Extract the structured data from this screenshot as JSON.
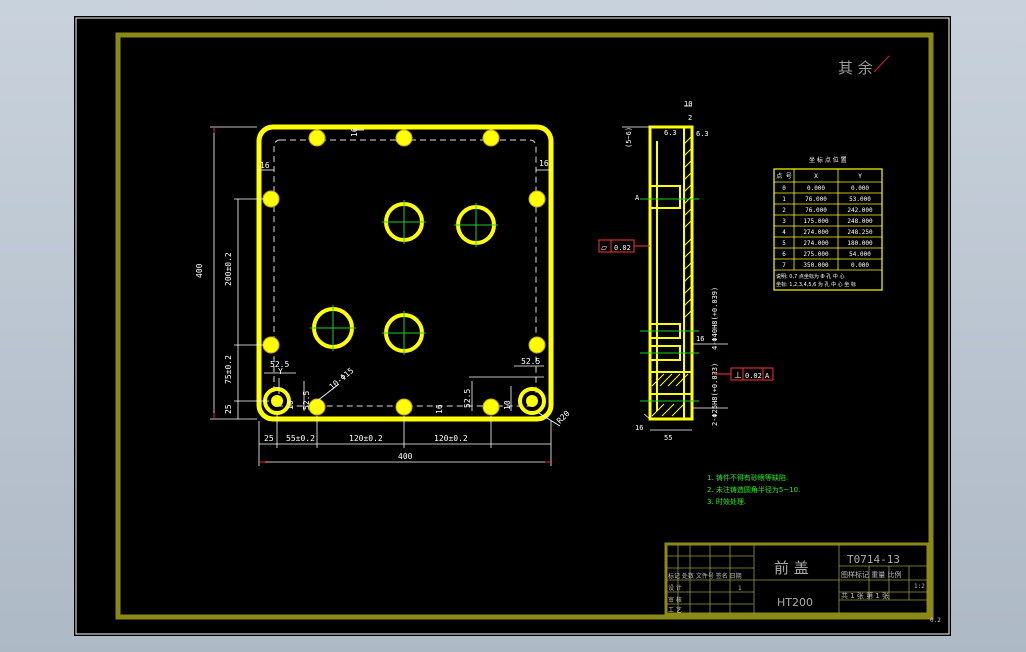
{
  "stamp": "其 余",
  "front_view": {
    "dims": {
      "d_400_v": "400",
      "d_200": "200±0.2",
      "d_75": "75±0.2",
      "d_25_v": "25",
      "d_16_top": "16",
      "d_16_left": "16",
      "d_16_right": "16",
      "d_525_a": "52.5",
      "d_525_b": "52.5",
      "d_525_c": "52.5",
      "d_525_d": "52.5",
      "d_10_a": "10",
      "d_10_b": "10",
      "d_16_bottom": "16",
      "d_25_h": "25",
      "d_55": "55±0.2",
      "d_120_a": "120±0.2",
      "d_120_b": "120±0.2",
      "d_400_h": "400",
      "d_hole": "10-Φ15",
      "d_r20": "R20",
      "y_label": "Y"
    }
  },
  "side_view": {
    "dims": {
      "t10": "10",
      "t63": "6.3",
      "t15": "(5~6)",
      "t2": "2",
      "tr": "6.3",
      "a_label": "A",
      "flat_sym": "▱",
      "flat_val": "0.02",
      "hole4": "4-Φ40H8(+0.039)",
      "hole2": "2-Φ25H8(+0.033)",
      "d16a": "16",
      "d16b": "16",
      "d55": "55",
      "perp_sym": "⊥",
      "perp_val": "0.02",
      "perp_ref": "A"
    }
  },
  "coord_table": {
    "title": "坐 标 点 位 置",
    "headers": [
      "点 号",
      "X",
      "Y"
    ],
    "rows": [
      [
        "0",
        "0.000",
        "0.000"
      ],
      [
        "1",
        "76.000",
        "53.000"
      ],
      [
        "2",
        "76.000",
        "242.000"
      ],
      [
        "3",
        "175.000",
        "248.000"
      ],
      [
        "4",
        "274.000",
        "248.250"
      ],
      [
        "5",
        "274.000",
        "180.000"
      ],
      [
        "6",
        "275.000",
        "54.000"
      ],
      [
        "7",
        "350.000",
        "0.000"
      ]
    ],
    "note1": "说明: 0,7 点坐标为 Ф 孔 中 心",
    "note2": "坐标: 1,2,3,4,5,6 为 孔 中 心 坐 标"
  },
  "notes": [
    "1. 铸件不得有砂眼等缺陷.",
    "2. 未注铸造圆角半径为5~10.",
    "3. 时效处理."
  ],
  "title_block": {
    "part_name": "前 盖",
    "drawing_no": "T0714-13",
    "material": "HT200",
    "attr_header": "图样标记  重量  比例",
    "ratio": "1:2",
    "sheet_info": "共 1 张  第 1 张",
    "rev_header": "标记 处数 文件号 签名 日期",
    "row_design": "设 计",
    "row_check": "审 核",
    "row_tech": "工 艺",
    "qty": "1"
  },
  "corner_note": "0.2"
}
